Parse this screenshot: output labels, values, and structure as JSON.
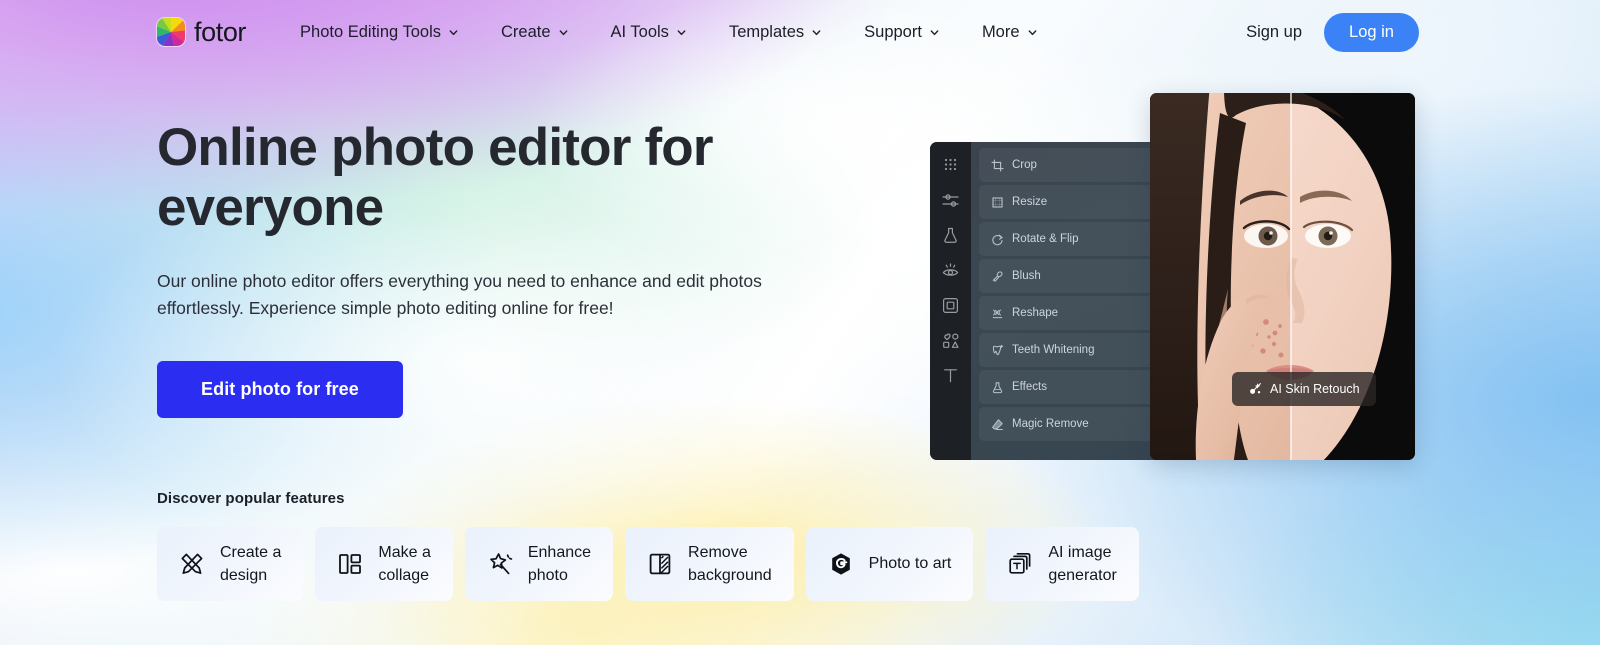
{
  "header": {
    "brand": "fotor",
    "logo_icon": "fotor-rainbow-pinwheel-logo",
    "nav": [
      {
        "label": "Photo Editing Tools",
        "caret": "chevron-down-icon"
      },
      {
        "label": "Create",
        "caret": "chevron-down-icon"
      },
      {
        "label": "AI Tools",
        "caret": "chevron-down-icon"
      },
      {
        "label": "Templates",
        "caret": "chevron-down-icon"
      },
      {
        "label": "Support",
        "caret": "chevron-down-icon"
      },
      {
        "label": "More",
        "caret": "chevron-down-icon"
      }
    ],
    "signup_label": "Sign up",
    "login_label": "Log in",
    "login_color": "#3b82f6"
  },
  "hero": {
    "headline": "Online photo editor for everyone",
    "subcopy": "Our online photo editor offers everything you need to enhance and edit photos effortlessly. Experience simple photo editing online for free!",
    "cta_label": "Edit photo for free",
    "cta_color": "#2b2ef0",
    "headline_color": "#25282f"
  },
  "mockup": {
    "sidebar_icons": [
      "grid-dots-icon",
      "adjust-sliders-icon",
      "beauty-flask-icon",
      "eye-icon",
      "frame-icon",
      "shapes-icon",
      "text-tool-icon"
    ],
    "menu_items": [
      {
        "label": "Crop",
        "icon": "crop-icon"
      },
      {
        "label": "Resize",
        "icon": "resize-icon"
      },
      {
        "label": "Rotate & Flip",
        "icon": "rotate-icon"
      },
      {
        "label": "Blush",
        "icon": "blush-icon"
      },
      {
        "label": "Reshape",
        "icon": "reshape-icon"
      },
      {
        "label": "Teeth Whitening",
        "icon": "teeth-icon"
      },
      {
        "label": "Effects",
        "icon": "effects-icon"
      },
      {
        "label": "Magic Remove",
        "icon": "magic-remove-icon"
      }
    ],
    "badge_label": "AI Skin Retouch",
    "badge_icon": "sparkle-wand-icon",
    "photo_alt": "before-after-skin-retouch-portrait"
  },
  "discover": {
    "title": "Discover popular features",
    "cards": [
      {
        "label": "Create a\ndesign",
        "icon": "pen-ruler-icon"
      },
      {
        "label": "Make a\ncollage",
        "icon": "collage-grid-icon"
      },
      {
        "label": "Enhance\nphoto",
        "icon": "magic-sparkle-icon"
      },
      {
        "label": "Remove\nbackground",
        "icon": "remove-bg-icon"
      },
      {
        "label": "Photo to art",
        "icon": "hexagon-art-icon"
      },
      {
        "label": "AI image\ngenerator",
        "icon": "ai-image-stack-icon"
      }
    ]
  }
}
